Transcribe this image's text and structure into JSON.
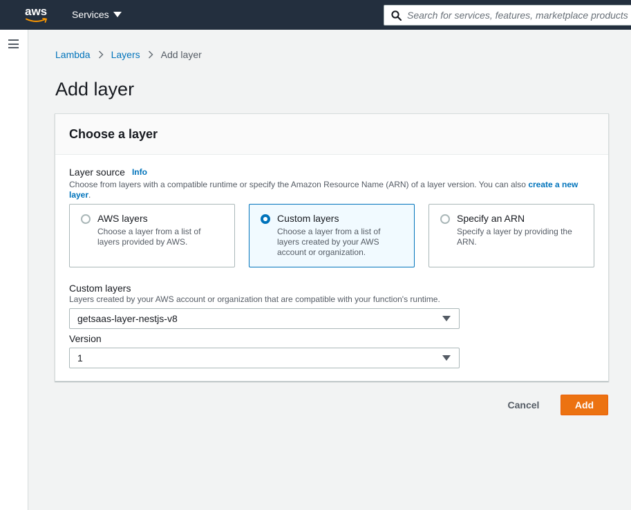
{
  "topnav": {
    "logo_text": "aws",
    "services_label": "Services",
    "search_placeholder": "Search for services, features, marketplace products, and docs"
  },
  "breadcrumb": {
    "items": [
      "Lambda",
      "Layers"
    ],
    "current": "Add layer"
  },
  "page": {
    "title": "Add layer"
  },
  "panel": {
    "title": "Choose a layer",
    "layer_source": {
      "label": "Layer source",
      "info": "Info",
      "description_before": "Choose from layers with a compatible runtime or specify the Amazon Resource Name (ARN) of a layer version. You can also ",
      "description_link": "create a new layer",
      "description_after": "."
    },
    "tiles": [
      {
        "title": "AWS layers",
        "description": "Choose a layer from a list of layers provided by AWS.",
        "selected": false
      },
      {
        "title": "Custom layers",
        "description": "Choose a layer from a list of layers created by your AWS account or organization.",
        "selected": true
      },
      {
        "title": "Specify an ARN",
        "description": "Specify a layer by providing the ARN.",
        "selected": false
      }
    ],
    "custom_layers": {
      "label": "Custom layers",
      "description": "Layers created by your AWS account or organization that are compatible with your function's runtime.",
      "value": "getsaas-layer-nestjs-v8"
    },
    "version": {
      "label": "Version",
      "value": "1"
    }
  },
  "actions": {
    "cancel_label": "Cancel",
    "add_label": "Add"
  },
  "colors": {
    "nav_bg": "#232f3e",
    "link": "#0073bb",
    "primary_button": "#ec7211",
    "selected_tile_bg": "#f1faff"
  }
}
